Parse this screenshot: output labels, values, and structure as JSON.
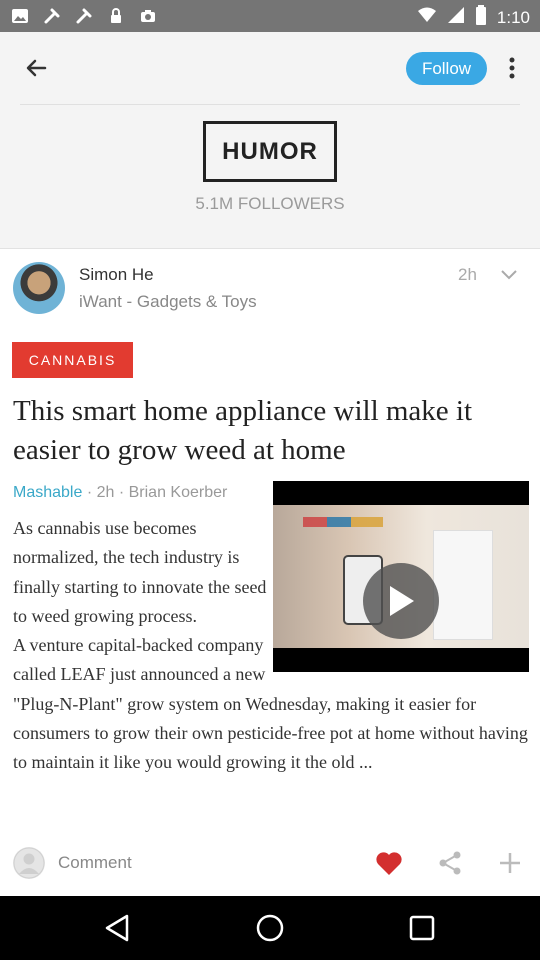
{
  "status_bar": {
    "time": "1:10",
    "left_icons": [
      "image-icon",
      "tools-icon",
      "tools-icon",
      "lock-icon",
      "camera-icon"
    ],
    "right_icons": [
      "wifi-icon",
      "signal-icon",
      "battery-icon"
    ]
  },
  "header": {
    "follow_label": "Follow"
  },
  "topic": {
    "name": "HUMOR",
    "followers": "5.1M FOLLOWERS"
  },
  "post": {
    "author_name": "Simon He",
    "author_source": "iWant - Gadgets & Toys",
    "time": "2h",
    "tag": "CANNABIS",
    "headline": "This smart home appliance will make it easier to grow weed at home",
    "meta_source": "Mashable",
    "meta_rest": " · 2h · Brian Koerber",
    "body_p1": "As cannabis use becomes normalized, the tech industry is finally starting to innovate the seed to weed growing process.",
    "body_p2": "A venture capital-backed company called LEAF just announced a new \"Plug-N-Plant\" grow system on Wednesday, making it easier for consumers to grow their own pesticide-free pot at home without having to maintain it like you would growing it the old ..."
  },
  "actions": {
    "comment_label": "Comment"
  },
  "colors": {
    "accent": "#3aa8e4",
    "tag": "#e23b30",
    "heart": "#d32f2f",
    "status_bar": "#757575"
  }
}
